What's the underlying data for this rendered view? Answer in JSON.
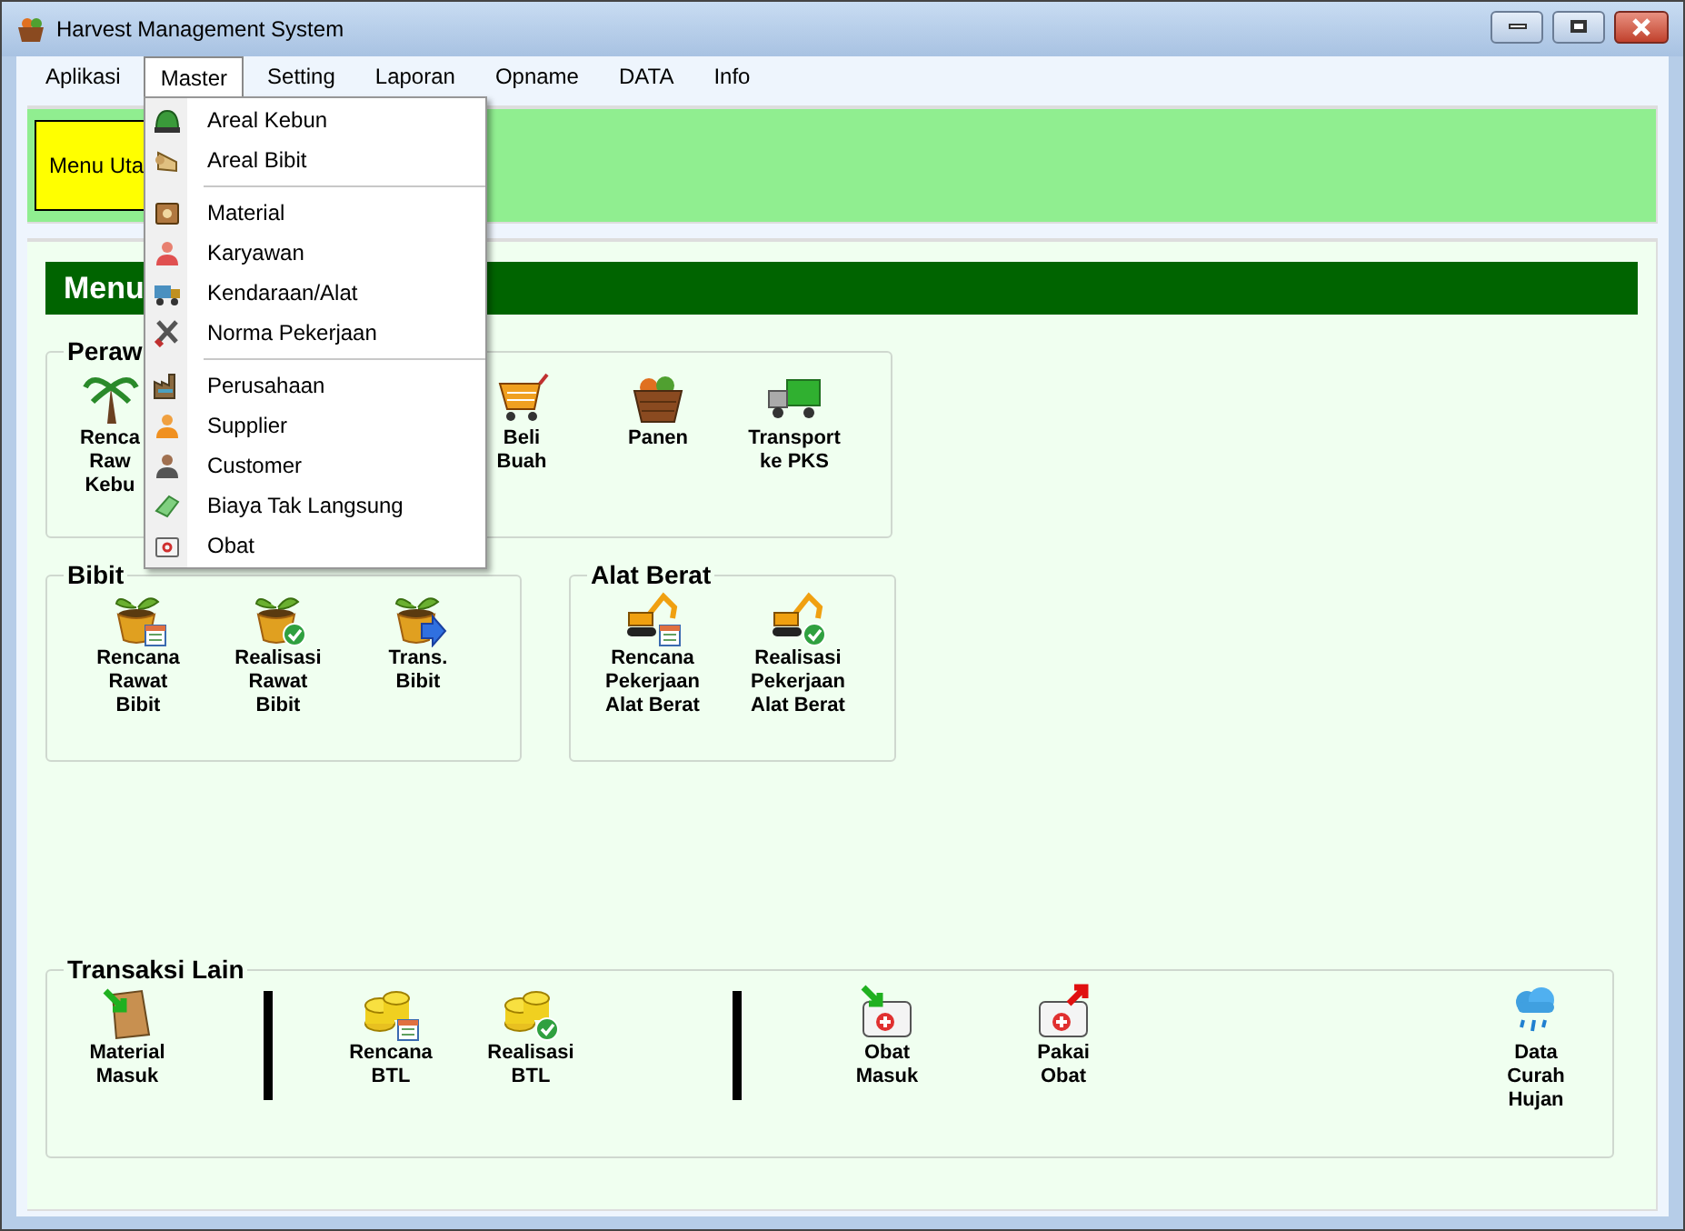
{
  "window": {
    "title": "Harvest Management System"
  },
  "menubar": [
    {
      "label": "Aplikasi",
      "selected": false
    },
    {
      "label": "Master",
      "selected": true
    },
    {
      "label": "Setting",
      "selected": false
    },
    {
      "label": "Laporan",
      "selected": false
    },
    {
      "label": "Opname",
      "selected": false
    },
    {
      "label": "DATA",
      "selected": false
    },
    {
      "label": "Info",
      "selected": false
    }
  ],
  "dropdown": {
    "sections": [
      [
        "Areal Kebun",
        "Areal Bibit"
      ],
      [
        "Material",
        "Karyawan",
        "Kendaraan/Alat",
        "Norma Pekerjaan"
      ],
      [
        "Perusahaan",
        "Supplier",
        "Customer",
        "Biaya Tak Langsung",
        "Obat"
      ]
    ]
  },
  "banner": {
    "label": "Menu Uta"
  },
  "header": "Menu",
  "groups": [
    {
      "title": "Peraw",
      "items": [
        {
          "kind": "launcher",
          "lines": [
            "Renca",
            "Raw",
            "Kebu"
          ]
        },
        {
          "kind": "launcher",
          "lines": [
            "Beli",
            "Buah"
          ]
        },
        {
          "kind": "launcher",
          "lines": [
            "Panen"
          ]
        },
        {
          "kind": "launcher",
          "lines": [
            "Transport",
            "ke PKS"
          ]
        }
      ]
    },
    {
      "title": "Bibit",
      "items": [
        {
          "kind": "launcher",
          "lines": [
            "Rencana",
            "Rawat",
            "Bibit"
          ]
        },
        {
          "kind": "launcher",
          "lines": [
            "Realisasi",
            "Rawat",
            "Bibit"
          ]
        },
        {
          "kind": "launcher",
          "lines": [
            "Trans.",
            "Bibit"
          ]
        }
      ]
    },
    {
      "title": "Alat Berat",
      "items": [
        {
          "kind": "launcher",
          "lines": [
            "Rencana",
            "Pekerjaan",
            "Alat Berat"
          ]
        },
        {
          "kind": "launcher",
          "lines": [
            "Realisasi",
            "Pekerjaan",
            "Alat Berat"
          ]
        }
      ]
    },
    {
      "title": "Transaksi Lain",
      "items": [
        {
          "kind": "launcher",
          "lines": [
            "Material",
            "Masuk"
          ]
        },
        {
          "kind": "separator"
        },
        {
          "kind": "launcher",
          "lines": [
            "Rencana",
            "BTL"
          ]
        },
        {
          "kind": "launcher",
          "lines": [
            "Realisasi",
            "BTL"
          ]
        },
        {
          "kind": "separator"
        },
        {
          "kind": "launcher",
          "lines": [
            "Obat",
            "Masuk"
          ]
        },
        {
          "kind": "launcher",
          "lines": [
            "Pakai",
            "Obat"
          ]
        },
        {
          "kind": "launcher",
          "lines": [
            "Data",
            "Curah",
            "Hujan"
          ]
        }
      ]
    }
  ]
}
